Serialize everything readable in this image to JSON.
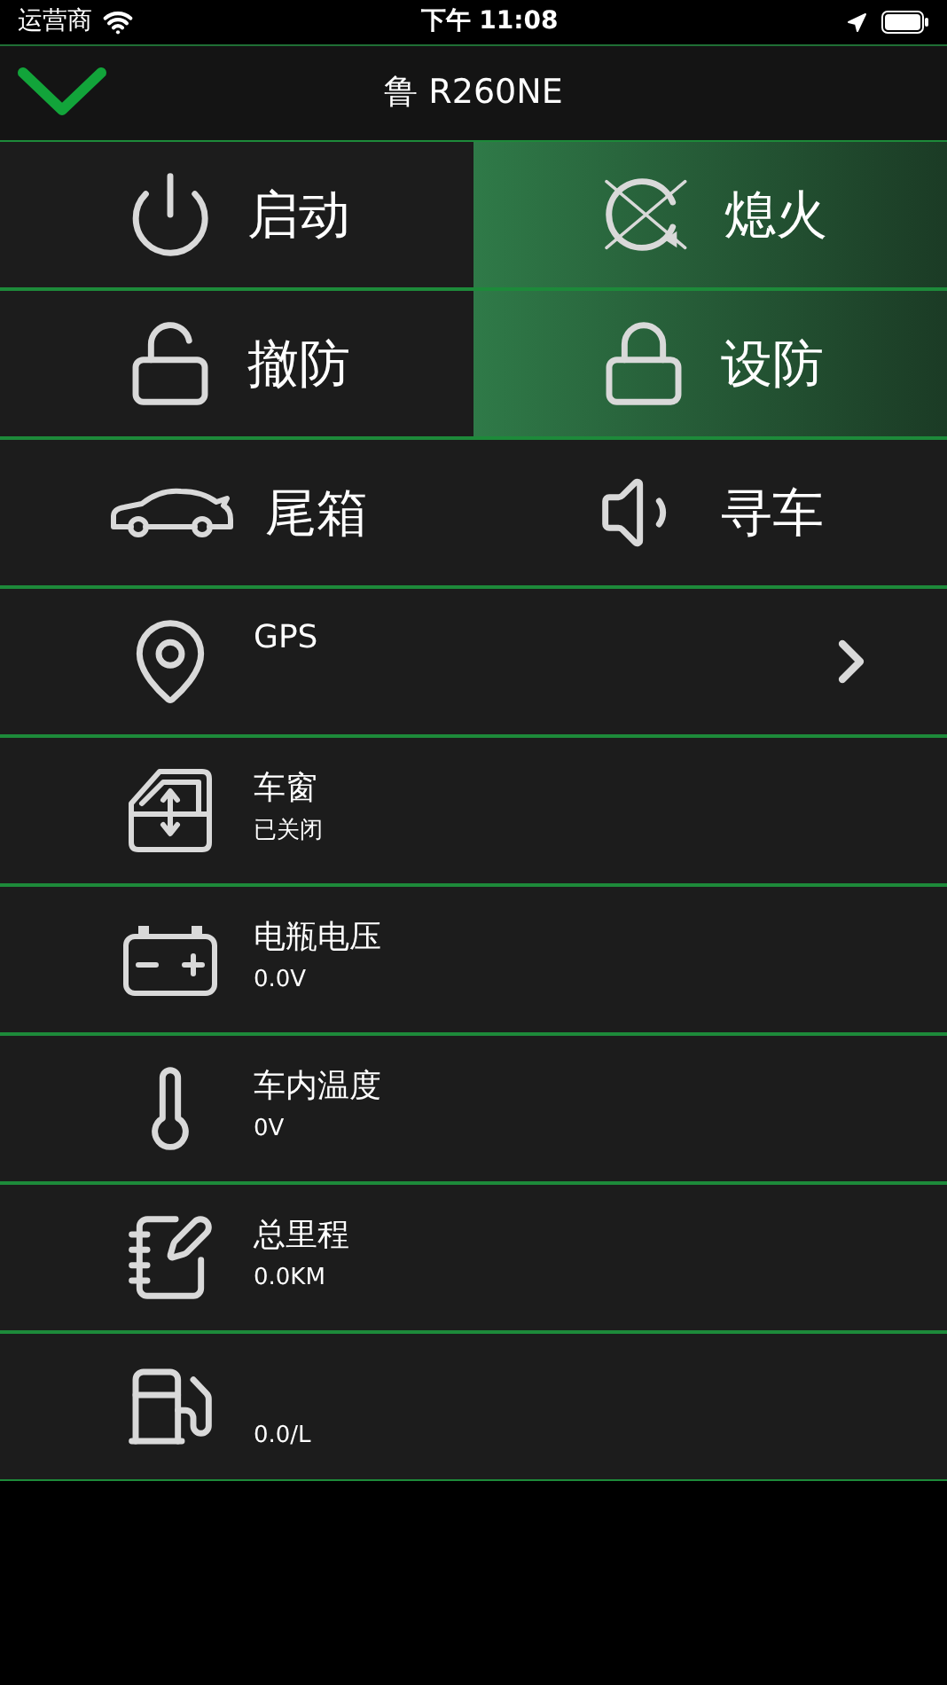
{
  "status_bar": {
    "carrier": "运营商",
    "time": "下午 11:08"
  },
  "header": {
    "title": "鲁 R260NE"
  },
  "button_rows": [
    [
      {
        "label": "启动",
        "selected": false
      },
      {
        "label": "熄火",
        "selected": true
      }
    ],
    [
      {
        "label": "撤防",
        "selected": false
      },
      {
        "label": "设防",
        "selected": true
      }
    ],
    [
      {
        "label": "尾箱",
        "selected": false
      },
      {
        "label": "寻车",
        "selected": false
      }
    ]
  ],
  "info_rows": [
    {
      "kind": "link",
      "title": "GPS"
    },
    {
      "kind": "info",
      "title": "车窗",
      "value": "已关闭"
    },
    {
      "kind": "info",
      "title": "电瓶电压",
      "value": "0.0V"
    },
    {
      "kind": "info",
      "title": "车内温度",
      "value": "0V"
    },
    {
      "kind": "info",
      "title": "总里程",
      "value": "0.0KM"
    },
    {
      "kind": "info",
      "value": "0.0/L"
    }
  ]
}
